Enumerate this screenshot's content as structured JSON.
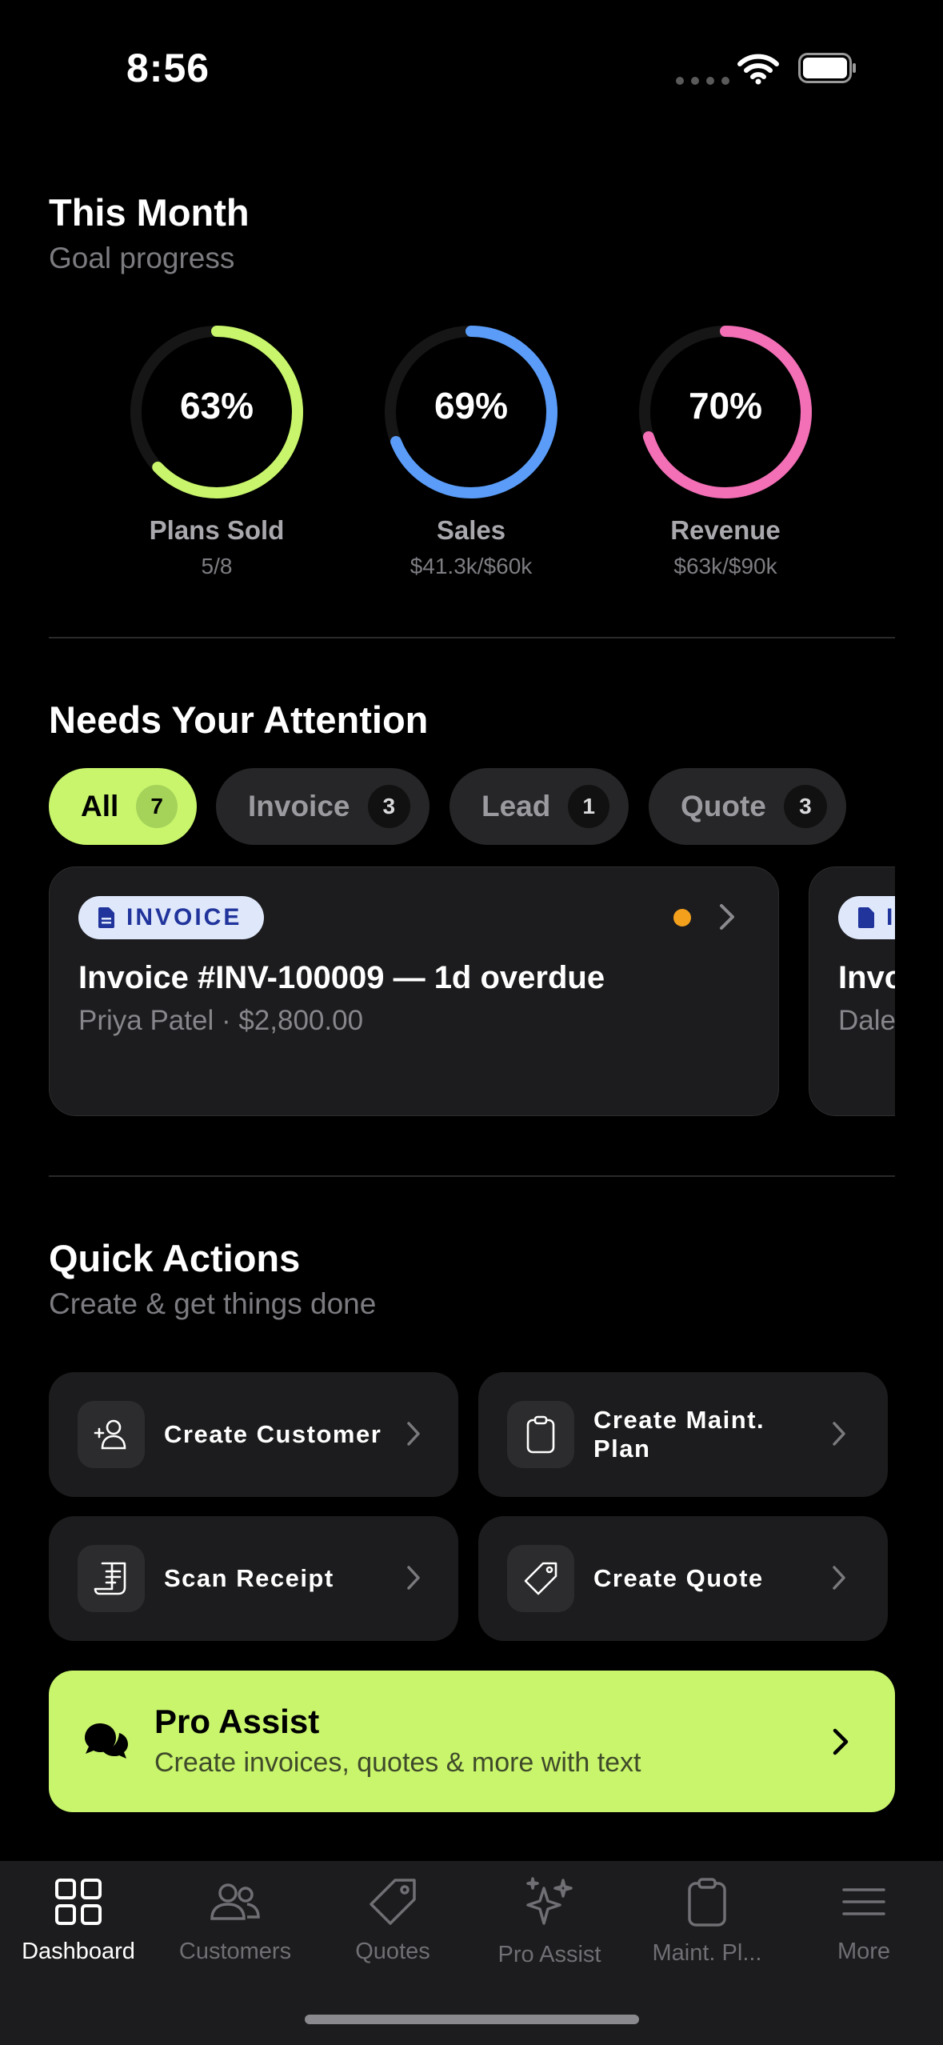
{
  "status_bar": {
    "time": "8:56"
  },
  "goals": {
    "title": "This Month",
    "subtitle": "Goal progress",
    "items": [
      {
        "pct_label": "63%",
        "progress": 0.63,
        "label": "Plans Sold",
        "value": "5/8",
        "color": "#c8f56c"
      },
      {
        "pct_label": "69%",
        "progress": 0.69,
        "label": "Sales",
        "value": "$41.3k/$60k",
        "color": "#5a9cf8"
      },
      {
        "pct_label": "70%",
        "progress": 0.7,
        "label": "Revenue",
        "value": "$63k/$90k",
        "color": "#f36fb6"
      }
    ]
  },
  "attention": {
    "title": "Needs Your Attention",
    "filters": [
      {
        "label": "All",
        "count": "7",
        "active": true
      },
      {
        "label": "Invoice",
        "count": "3",
        "active": false
      },
      {
        "label": "Lead",
        "count": "1",
        "active": false
      },
      {
        "label": "Quote",
        "count": "3",
        "active": false
      }
    ],
    "cards": [
      {
        "badge": "INVOICE",
        "title": "Invoice #INV-100009 — 1d overdue",
        "subtitle": "Priya Patel · $2,800.00",
        "dot_color": "#f3a01d"
      },
      {
        "badge": "INVOICE",
        "title": "Invoice",
        "subtitle": "Dale"
      }
    ]
  },
  "quick_actions": {
    "title": "Quick Actions",
    "subtitle": "Create & get things done",
    "items": [
      {
        "label": "Create Customer",
        "icon": "person-plus-icon"
      },
      {
        "label": "Create Maint. Plan",
        "line1": "Create Maint.",
        "line2": "Plan",
        "icon": "clipboard-icon"
      },
      {
        "label": "Scan Receipt",
        "icon": "receipt-icon"
      },
      {
        "label": "Create Quote",
        "icon": "tag-icon"
      }
    ]
  },
  "pro_assist": {
    "title": "Pro Assist",
    "subtitle": "Create invoices, quotes & more with text"
  },
  "tab_bar": {
    "items": [
      {
        "label": "Dashboard",
        "icon": "grid-icon",
        "active": true
      },
      {
        "label": "Customers",
        "icon": "people-icon",
        "active": false
      },
      {
        "label": "Quotes",
        "icon": "tag-icon",
        "active": false
      },
      {
        "label": "Pro Assist",
        "icon": "sparkles-icon",
        "active": false
      },
      {
        "label": "Maint. Pl...",
        "icon": "clipboard-icon",
        "active": false
      },
      {
        "label": "More",
        "icon": "menu-icon",
        "active": false
      }
    ]
  }
}
